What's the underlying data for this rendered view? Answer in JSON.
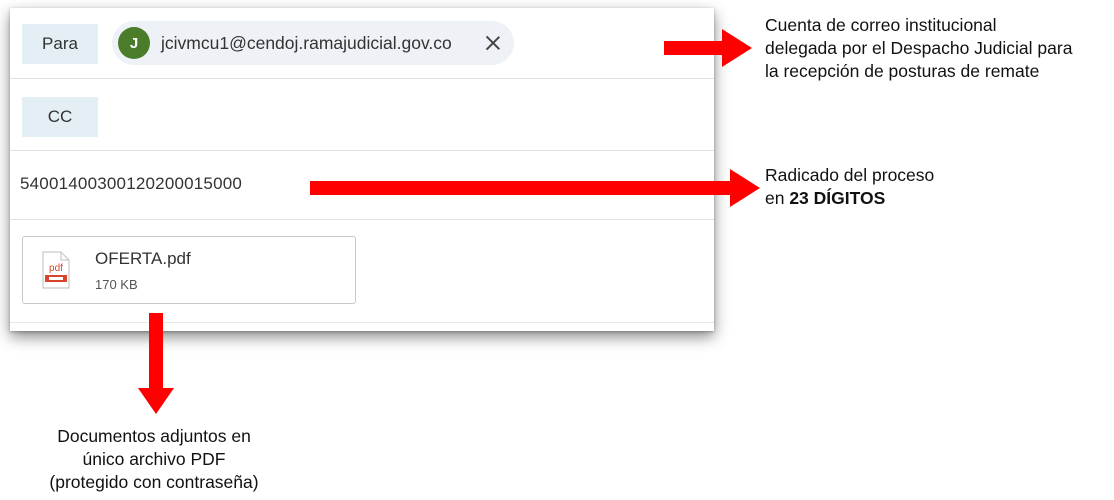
{
  "email": {
    "to_label": "Para",
    "to_avatar_initial": "J",
    "to_address": "jcivmcu1@cendoj.ramajudicial.gov.co",
    "cc_label": "CC",
    "subject": "54001400300120200015000",
    "attachment": {
      "name": "OFERTA.pdf",
      "size": "170 KB",
      "icon_text": "pdf",
      "icon": "pdf-file-icon"
    },
    "avatar_color": "#4a7c2a"
  },
  "annotations": {
    "recipient_note": [
      "Cuenta de correo institucional",
      "delegada por el Despacho Judicial para",
      "la recepción de posturas de remate"
    ],
    "subject_note_line1": "Radicado del proceso",
    "subject_note_prefix": "en ",
    "subject_note_bold": "23 DÍGITOS",
    "attachment_note": [
      "Documentos adjuntos en",
      "único archivo PDF",
      "(protegido con contraseña)"
    ],
    "arrow_color": "#ff0000"
  }
}
